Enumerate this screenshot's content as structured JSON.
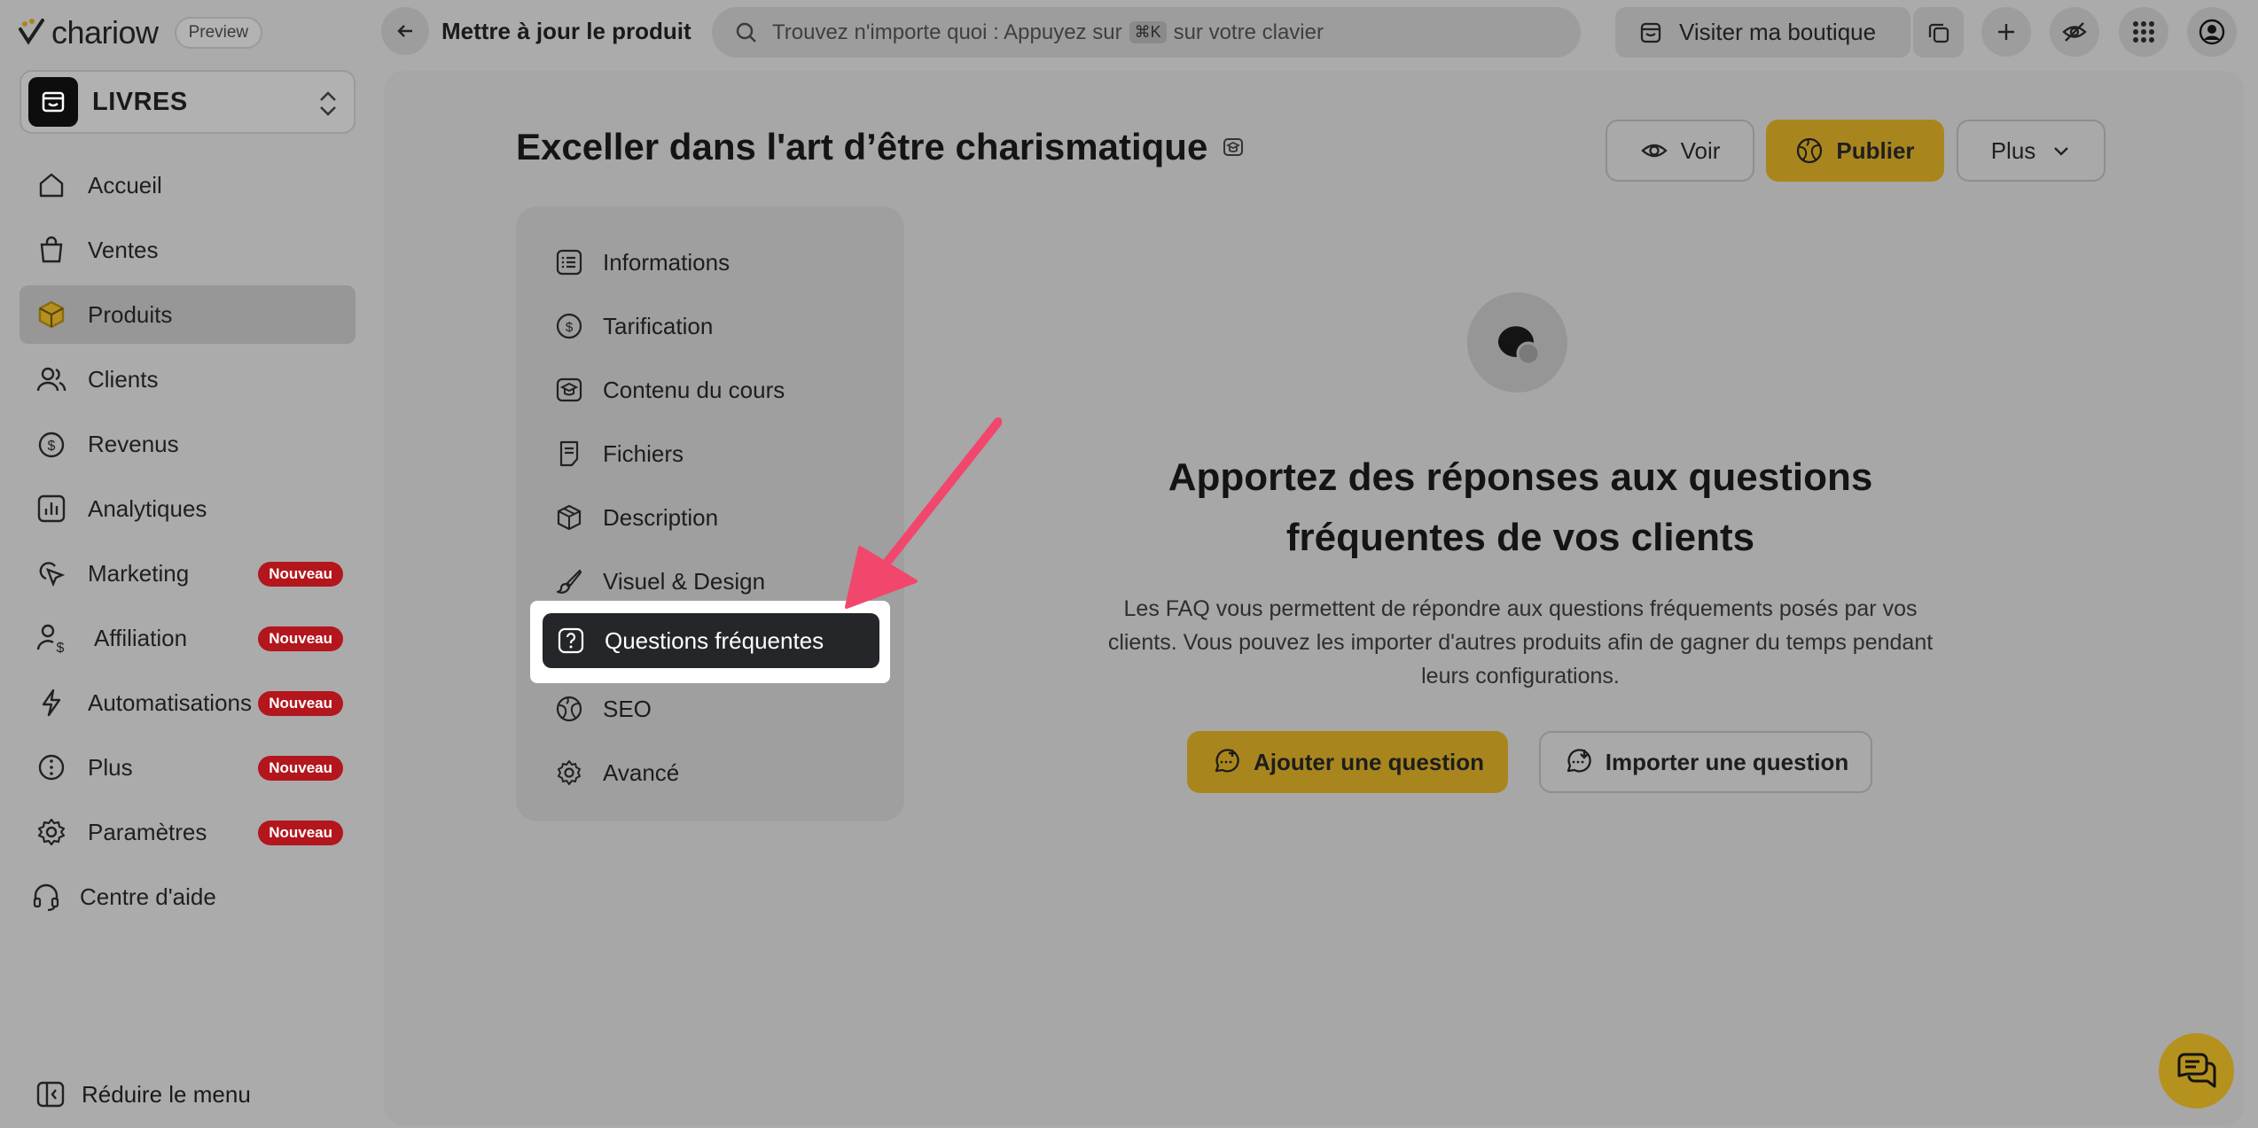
{
  "brand": {
    "name": "chariow",
    "preview_label": "Preview"
  },
  "store": {
    "name": "LIVRES"
  },
  "nav": {
    "items": [
      {
        "label": "Accueil",
        "icon": "home-icon",
        "active": false,
        "badge": ""
      },
      {
        "label": "Ventes",
        "icon": "shopping-bag-icon",
        "active": false,
        "badge": ""
      },
      {
        "label": "Produits",
        "icon": "box-icon",
        "active": true,
        "badge": ""
      },
      {
        "label": "Clients",
        "icon": "users-icon",
        "active": false,
        "badge": ""
      },
      {
        "label": "Revenus",
        "icon": "dollar-circle-icon",
        "active": false,
        "badge": ""
      },
      {
        "label": "Analytiques",
        "icon": "chart-icon",
        "active": false,
        "badge": ""
      },
      {
        "label": "Marketing",
        "icon": "cursor-click-icon",
        "active": false,
        "badge": "Nouveau"
      },
      {
        "label": "Affiliation",
        "icon": "user-dollar-icon",
        "active": false,
        "badge": "Nouveau"
      },
      {
        "label": "Automatisations",
        "icon": "lightning-icon",
        "active": false,
        "badge": "Nouveau"
      },
      {
        "label": "Plus",
        "icon": "more-circle-icon",
        "active": false,
        "badge": "Nouveau"
      },
      {
        "label": "Paramètres",
        "icon": "gear-icon",
        "active": false,
        "badge": "Nouveau"
      },
      {
        "label": "Centre d'aide",
        "icon": "headset-icon",
        "active": false,
        "badge": ""
      }
    ],
    "collapse_label": "Réduire le menu"
  },
  "topbar": {
    "title": "Mettre à jour le produit",
    "search_prefix": "Trouvez n'importe quoi : Appuyez sur",
    "search_kbd": "⌘K",
    "search_suffix": "sur votre clavier",
    "visit_label": "Visiter ma boutique"
  },
  "product": {
    "title": "Exceller dans l'art d’être charismatique",
    "voir_label": "Voir",
    "publier_label": "Publier",
    "plus_label": "Plus"
  },
  "tabs": [
    {
      "label": "Informations",
      "icon": "list-icon"
    },
    {
      "label": "Tarification",
      "icon": "dollar-circle-icon"
    },
    {
      "label": "Contenu du cours",
      "icon": "graduation-cap-icon"
    },
    {
      "label": "Fichiers",
      "icon": "file-icon"
    },
    {
      "label": "Description",
      "icon": "box-icon"
    },
    {
      "label": "Visuel & Design",
      "icon": "brush-icon"
    },
    {
      "label": "Questions fréquentes",
      "icon": "question-icon",
      "active": true
    },
    {
      "label": "SEO",
      "icon": "globe-icon"
    },
    {
      "label": "Avancé",
      "icon": "gear-icon"
    }
  ],
  "empty_state": {
    "title_line1": "Apportez des réponses aux questions",
    "title_line2": "fréquentes de vos clients",
    "desc_line1": "Les FAQ vous permettent de répondre aux questions fréquements posés par vos",
    "desc_line2": "clients. Vous pouvez les importer d'autres produits afin de gagner du temps pendant",
    "desc_line3": "leurs configurations.",
    "add_label": "Ajouter une question",
    "import_label": "Importer une question"
  },
  "colors": {
    "accent": "#a9861d",
    "badge": "#b3161c",
    "active_tab": "#25262a",
    "arrow": "#f2476c"
  }
}
